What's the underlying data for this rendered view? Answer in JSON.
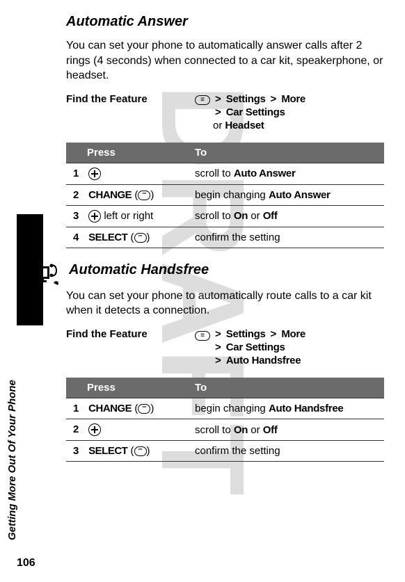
{
  "watermark": "DRAFT",
  "sideLabel": "Getting More Out Of Your Phone",
  "pageNumber": "106",
  "section1": {
    "title": "Automatic Answer",
    "description": "You can set your phone to automatically answer calls after 2 rings (4 seconds) when connected to a car kit, speakerphone, or headset.",
    "findFeatureLabel": "Find the Feature",
    "path": {
      "settings": "Settings",
      "more": "More",
      "carSettings": "Car Settings",
      "or": "or",
      "headset": "Headset"
    },
    "table": {
      "headers": {
        "press": "Press",
        "to": "To"
      },
      "rows": [
        {
          "num": "1",
          "press": {
            "type": "dpad",
            "suffix": ""
          },
          "to": {
            "prefix": "scroll to ",
            "bold": "Auto Answer"
          }
        },
        {
          "num": "2",
          "press": {
            "type": "softkey",
            "label": "CHANGE"
          },
          "to": {
            "prefix": "begin changing ",
            "bold": "Auto Answer"
          }
        },
        {
          "num": "3",
          "press": {
            "type": "dpad",
            "suffix": " left or right"
          },
          "to": {
            "prefix": "scroll to ",
            "bold": "On",
            "middle": " or ",
            "bold2": "Off"
          }
        },
        {
          "num": "4",
          "press": {
            "type": "softkey",
            "label": "SELECT"
          },
          "to": {
            "prefix": "confirm the setting"
          }
        }
      ]
    }
  },
  "section2": {
    "title": "Automatic Handsfree",
    "description": "You can set your phone to automatically route calls to a car kit when it detects a connection.",
    "findFeatureLabel": "Find the Feature",
    "path": {
      "settings": "Settings",
      "more": "More",
      "carSettings": "Car Settings",
      "autoHandsfree": "Auto Handsfree"
    },
    "table": {
      "headers": {
        "press": "Press",
        "to": "To"
      },
      "rows": [
        {
          "num": "1",
          "press": {
            "type": "softkey",
            "label": "CHANGE"
          },
          "to": {
            "prefix": "begin changing ",
            "bold": "Auto Handsfree"
          }
        },
        {
          "num": "2",
          "press": {
            "type": "dpad",
            "suffix": ""
          },
          "to": {
            "prefix": "scroll to ",
            "bold": "On",
            "middle": " or ",
            "bold2": "Off"
          }
        },
        {
          "num": "3",
          "press": {
            "type": "softkey",
            "label": "SELECT"
          },
          "to": {
            "prefix": "confirm the setting"
          }
        }
      ]
    }
  }
}
